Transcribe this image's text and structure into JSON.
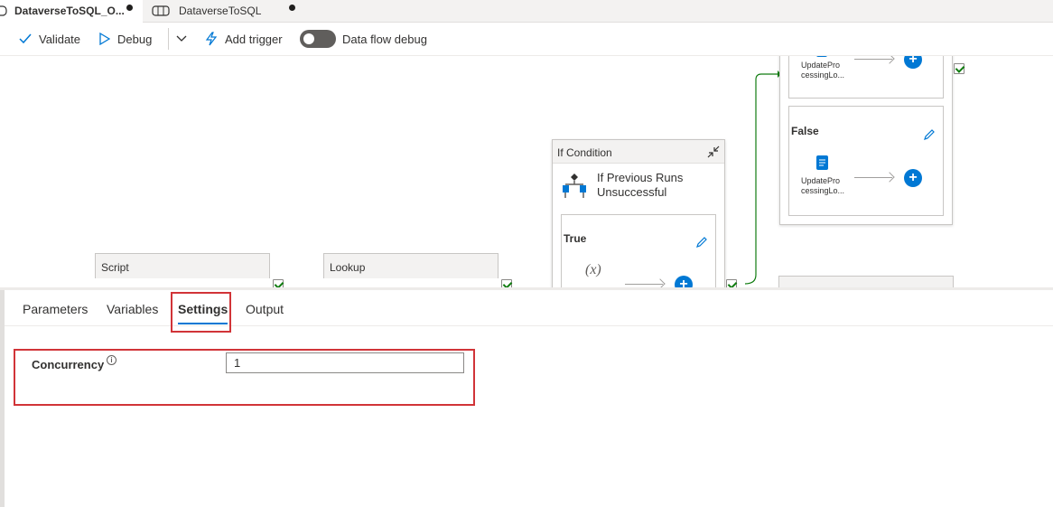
{
  "tabs": [
    {
      "label": "DataverseToSQL_O...",
      "active": true,
      "dirty": true
    },
    {
      "label": "DataverseToSQL",
      "active": false,
      "dirty": true
    }
  ],
  "toolbar": {
    "validate": "Validate",
    "debug": "Debug",
    "add_trigger": "Add trigger",
    "dataflow_debug": "Data flow debug",
    "dataflow_debug_on": false
  },
  "canvas": {
    "script_title": "Script",
    "lookup_title": "Lookup",
    "if_condition_title": "If Condition",
    "if_condition_name": "If Previous Runs Unsuccessful",
    "true_label": "True",
    "false_label": "False",
    "variable_glyph": "(x)",
    "update_activity_label_1": "UpdatePro",
    "update_activity_label_2": "cessingLo..."
  },
  "panel": {
    "tabs": [
      "Parameters",
      "Variables",
      "Settings",
      "Output"
    ],
    "active_tab": "Settings",
    "concurrency_label": "Concurrency",
    "concurrency_value": "1"
  },
  "colors": {
    "accent": "#0078d4",
    "highlight": "#d13438",
    "success": "#107c10"
  }
}
